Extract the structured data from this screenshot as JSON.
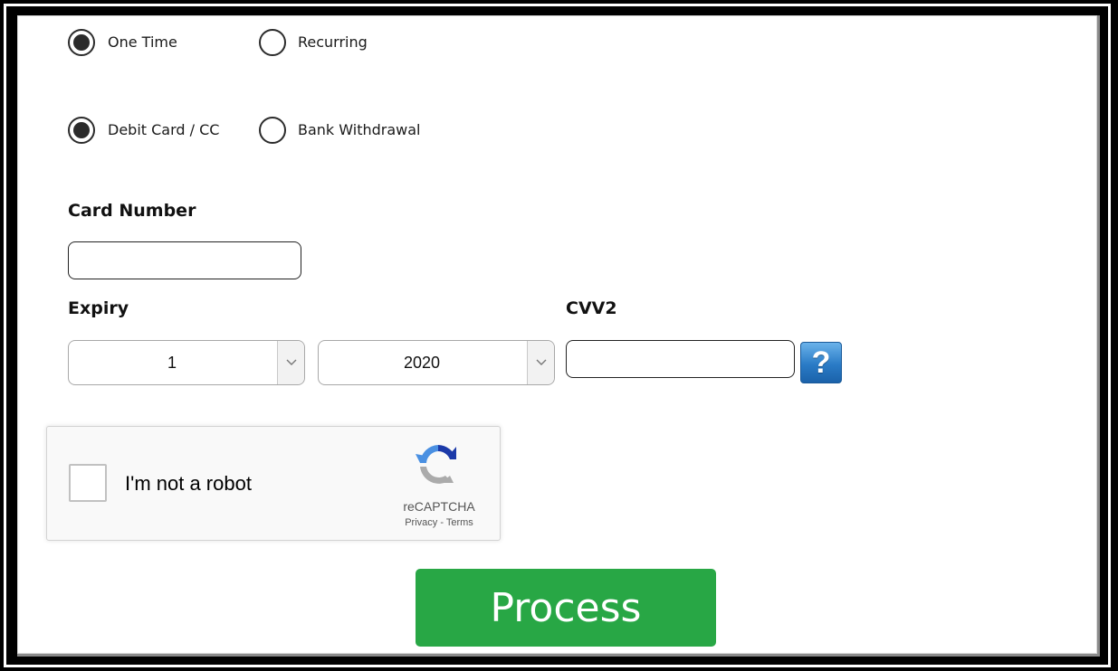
{
  "frequency": {
    "options": [
      {
        "label": "One Time",
        "checked": true
      },
      {
        "label": "Recurring",
        "checked": false
      }
    ]
  },
  "payment_method": {
    "options": [
      {
        "label": "Debit Card / CC",
        "checked": true
      },
      {
        "label": "Bank Withdrawal",
        "checked": false
      }
    ]
  },
  "card_number": {
    "label": "Card Number",
    "value": ""
  },
  "expiry": {
    "label": "Expiry",
    "month_value": "1",
    "year_value": "2020"
  },
  "cvv": {
    "label": "CVV2",
    "value": "",
    "help_glyph": "?"
  },
  "captcha": {
    "label": "I'm not a robot",
    "brand": "reCAPTCHA",
    "links": "Privacy - Terms",
    "checked": false
  },
  "submit": {
    "label": "Process",
    "color": "#28a745"
  },
  "icons": {
    "help": "help-question-icon",
    "dropdown": "chevron-down-icon",
    "recaptcha": "recaptcha-logo-icon"
  }
}
